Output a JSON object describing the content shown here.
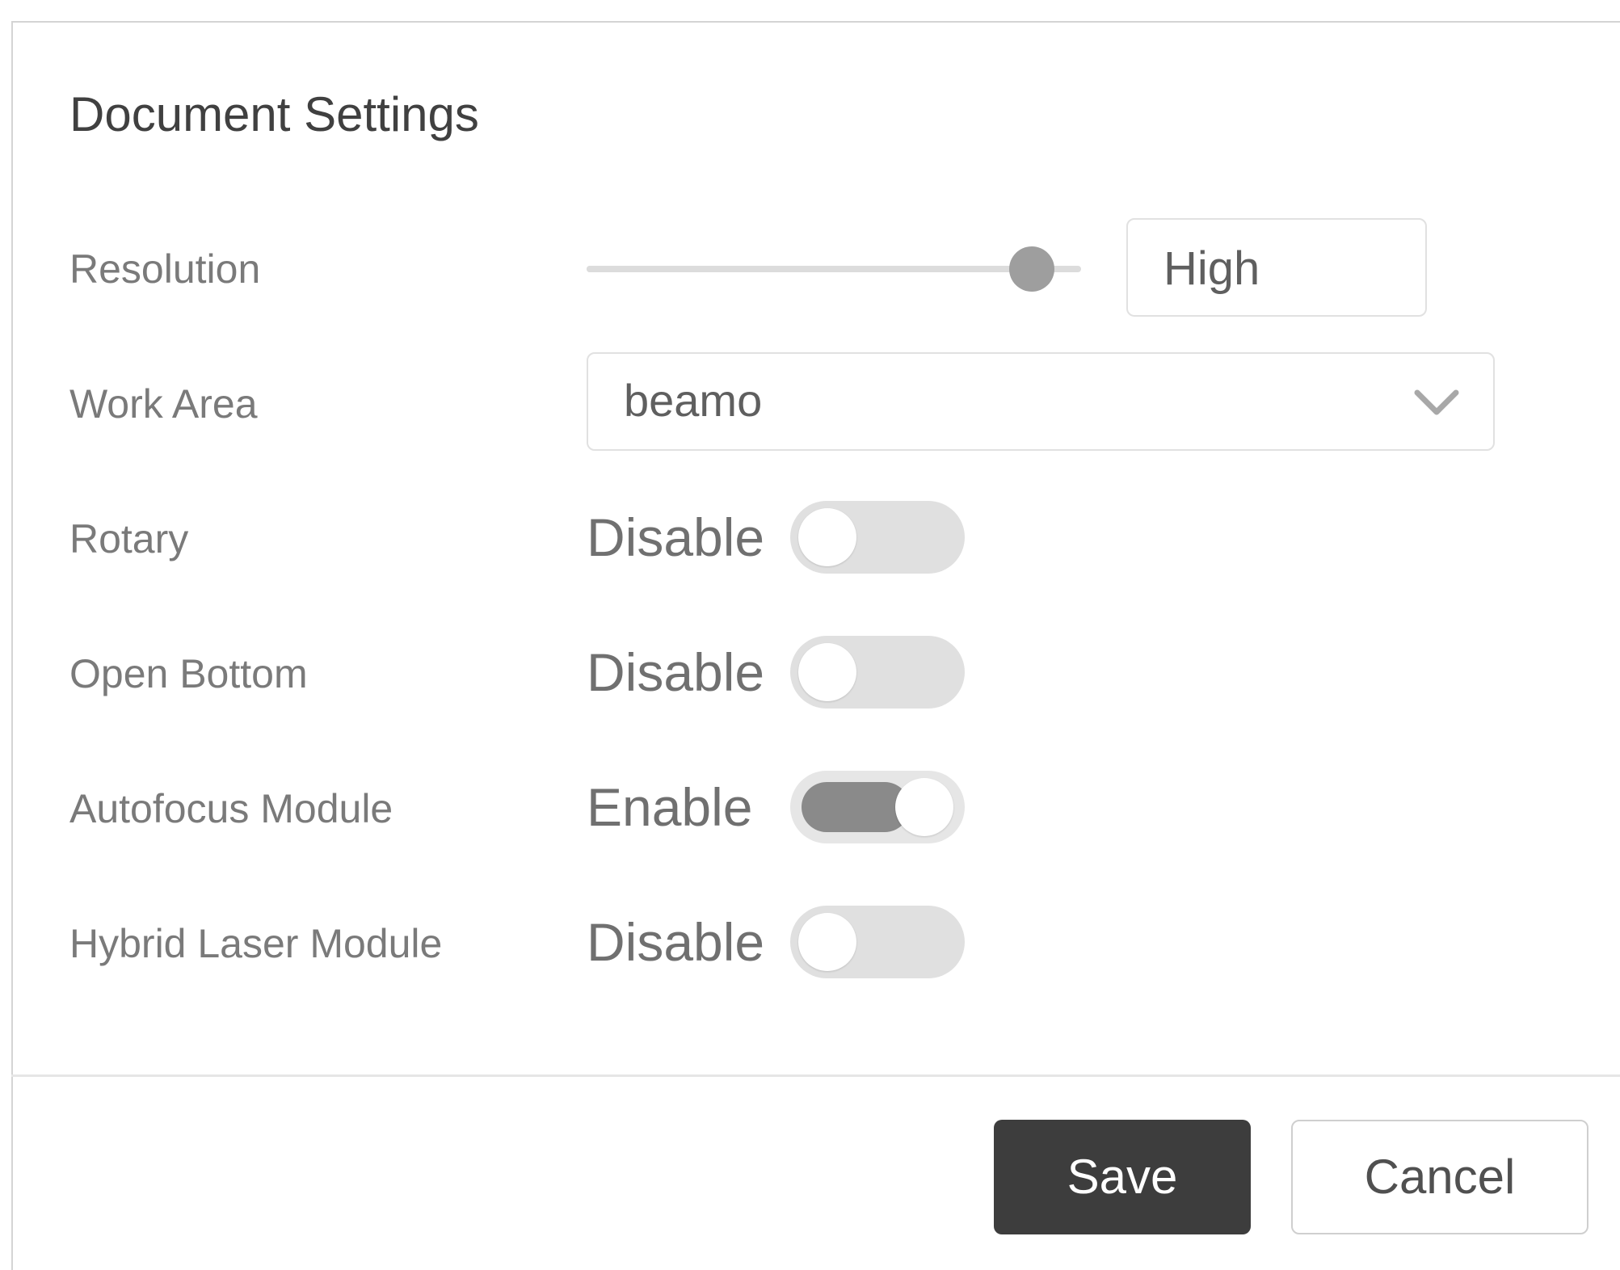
{
  "dialog": {
    "title": "Document Settings"
  },
  "resolution": {
    "label": "Resolution",
    "level": 0.9,
    "value": "High"
  },
  "work_area": {
    "label": "Work Area",
    "selected": "beamo"
  },
  "rotary": {
    "label": "Rotary",
    "state": "Disable",
    "enabled": false
  },
  "open_bottom": {
    "label": "Open Bottom",
    "state": "Disable",
    "enabled": false
  },
  "autofocus": {
    "label": "Autofocus Module",
    "state": "Enable",
    "enabled": true
  },
  "hybrid_laser": {
    "label": "Hybrid Laser Module",
    "state": "Disable",
    "enabled": false
  },
  "footer": {
    "save_label": "Save",
    "cancel_label": "Cancel"
  },
  "colors": {
    "primary_button": "#3d3d3d",
    "toggle_on": "#8a8a8a",
    "toggle_off": "#e0e0e0",
    "slider_thumb": "#9e9e9e"
  },
  "icons": {
    "select_arrow": "chevron-down-icon"
  }
}
